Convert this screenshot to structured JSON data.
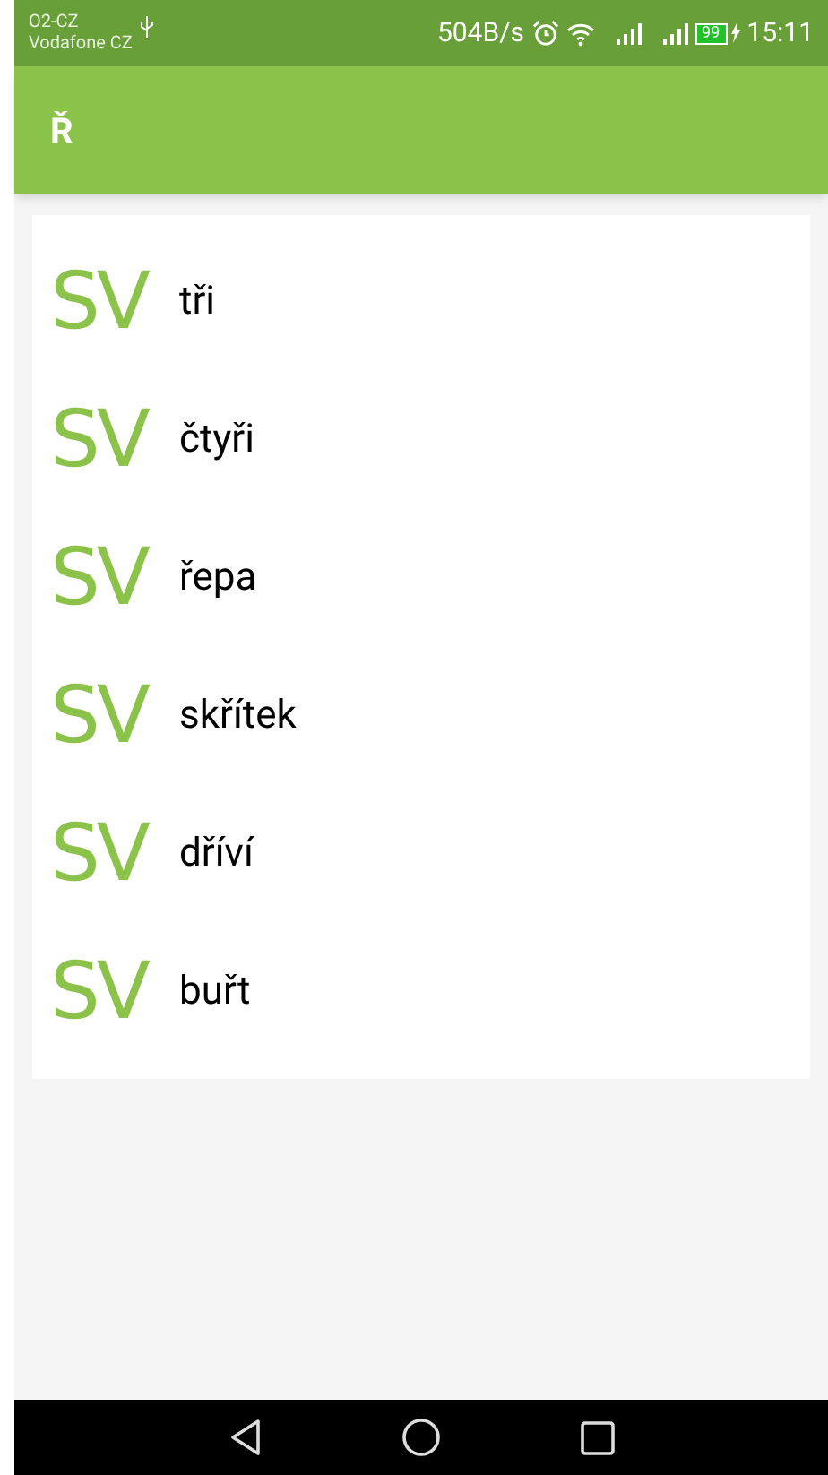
{
  "status_bar": {
    "carrier_1": "O2-CZ",
    "carrier_2": "Vodafone CZ",
    "speed": "504B/s",
    "battery": "99",
    "time": "15:11"
  },
  "app_bar": {
    "title": "Ř"
  },
  "items": [
    {
      "logo": "SV",
      "label": "tři"
    },
    {
      "logo": "SV",
      "label": "čtyři"
    },
    {
      "logo": "SV",
      "label": "řepa"
    },
    {
      "logo": "SV",
      "label": "skřítek"
    },
    {
      "logo": "SV",
      "label": "dříví"
    },
    {
      "logo": "SV",
      "label": "buřt"
    }
  ]
}
